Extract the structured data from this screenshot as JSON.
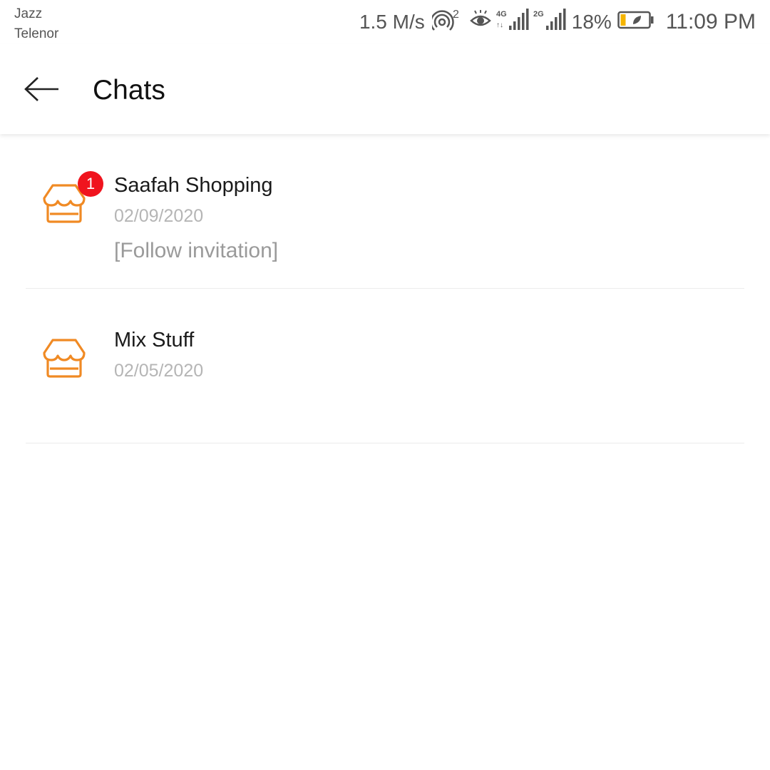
{
  "status_bar": {
    "carrier_1": "Jazz",
    "carrier_2": "Telenor",
    "network_speed": "1.5 M/s",
    "hotspot_count": "2",
    "network_1": "4G",
    "network_2": "2G",
    "battery_percent": "18%",
    "time": "11:09 PM",
    "icons": [
      "hotspot-icon",
      "eye-icon",
      "signal-4g-icon",
      "signal-2g-icon",
      "battery-icon"
    ]
  },
  "header": {
    "title": "Chats",
    "back_icon": "arrow-left-icon"
  },
  "chats": [
    {
      "name": "Saafah Shopping",
      "date": "02/09/2020",
      "preview": "[Follow invitation]",
      "unread": "1",
      "icon": "store-icon"
    },
    {
      "name": "Mix Stuff",
      "date": "02/05/2020",
      "preview": "",
      "icon": "store-icon"
    }
  ],
  "colors": {
    "accent": "#f08a24",
    "badge": "#f0141e",
    "battery_fill": "#f5b400"
  }
}
